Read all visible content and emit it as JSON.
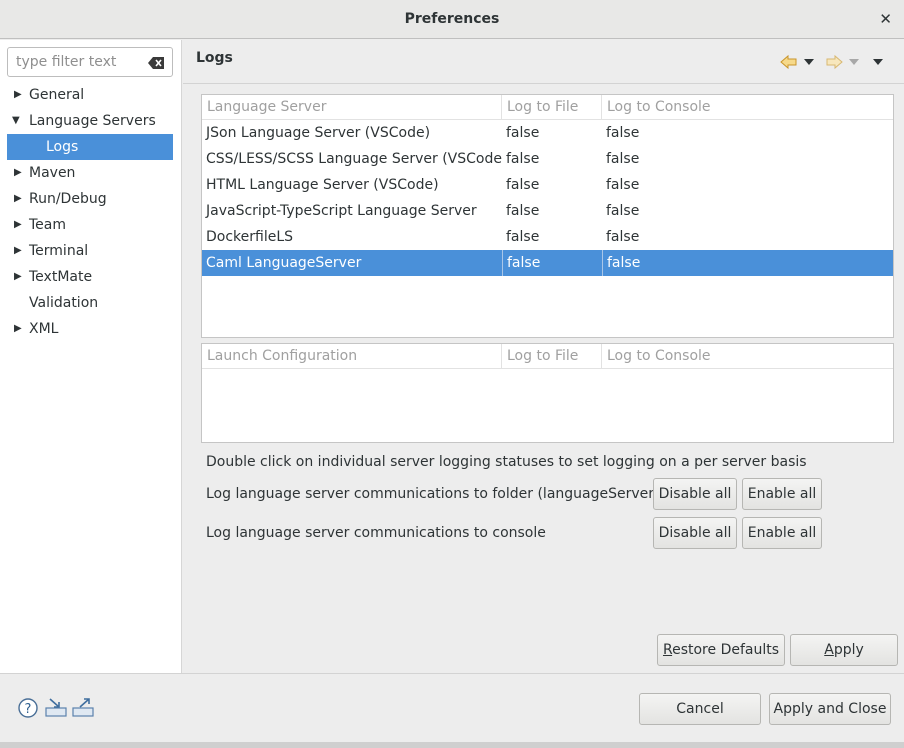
{
  "window": {
    "title": "Preferences"
  },
  "filter": {
    "placeholder": "type filter text"
  },
  "tree": [
    {
      "label": "General",
      "expandable": true,
      "expanded": false,
      "level": 0
    },
    {
      "label": "Language Servers",
      "expandable": true,
      "expanded": true,
      "level": 0
    },
    {
      "label": "Logs",
      "expandable": false,
      "level": 1,
      "selected": true
    },
    {
      "label": "Maven",
      "expandable": true,
      "expanded": false,
      "level": 0
    },
    {
      "label": "Run/Debug",
      "expandable": true,
      "expanded": false,
      "level": 0
    },
    {
      "label": "Team",
      "expandable": true,
      "expanded": false,
      "level": 0
    },
    {
      "label": "Terminal",
      "expandable": true,
      "expanded": false,
      "level": 0
    },
    {
      "label": "TextMate",
      "expandable": true,
      "expanded": false,
      "level": 0
    },
    {
      "label": "Validation",
      "expandable": false,
      "level": 0
    },
    {
      "label": "XML",
      "expandable": true,
      "expanded": false,
      "level": 0
    }
  ],
  "page": {
    "title": "Logs"
  },
  "servers_table": {
    "headers": [
      "Language Server",
      "Log to File",
      "Log to Console"
    ],
    "rows": [
      [
        "JSon Language Server (VSCode)",
        "false",
        "false"
      ],
      [
        "CSS/LESS/SCSS Language Server (VSCode)",
        "false",
        "false"
      ],
      [
        "HTML Language Server (VSCode)",
        "false",
        "false"
      ],
      [
        "JavaScript-TypeScript Language Server",
        "false",
        "false"
      ],
      [
        "DockerfileLS",
        "false",
        "false"
      ],
      [
        "Caml LanguageServer",
        "false",
        "false"
      ]
    ],
    "selected_row": 5
  },
  "launch_table": {
    "headers": [
      "Launch Configuration",
      "Log to File",
      "Log to Console"
    ]
  },
  "info": {
    "hint": "Double click on individual server logging statuses to set logging on a per server basis",
    "folder_label": "Log language server communications to folder (languageServers-log)",
    "console_label": "Log language server communications to console"
  },
  "buttons": {
    "disable_all": "Disable all",
    "enable_all": "Enable all",
    "restore_defaults": "Restore Defaults",
    "apply": "Apply",
    "cancel": "Cancel",
    "apply_close": "Apply and Close"
  },
  "colors": {
    "selection": "#4a90d9",
    "nav_arrow": "#e8b93a"
  }
}
